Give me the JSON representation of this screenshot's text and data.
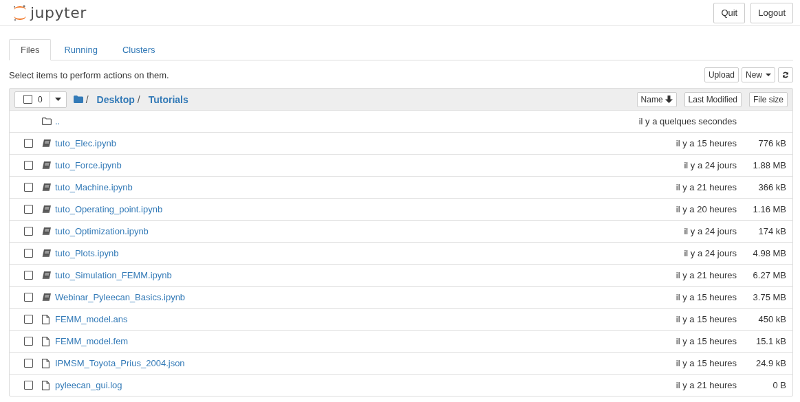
{
  "header": {
    "logo_text": "jupyter",
    "buttons": [
      "Quit",
      "Logout"
    ]
  },
  "tabs": [
    {
      "label": "Files",
      "selected": true
    },
    {
      "label": "Running",
      "selected": false
    },
    {
      "label": "Clusters",
      "selected": false
    }
  ],
  "hint": "Select items to perform actions on them.",
  "actions": {
    "upload": "Upload",
    "new": "New"
  },
  "list_header": {
    "select_all": {
      "checked": false,
      "count": "0"
    },
    "breadcrumb": [
      "Desktop",
      "Tutorials"
    ],
    "separator": "/",
    "sort_buttons": [
      {
        "label": "Name",
        "sorted": true
      },
      {
        "label": "Last Modified",
        "sorted": false
      },
      {
        "label": "File size",
        "sorted": false
      }
    ]
  },
  "items": [
    {
      "kind": "parent",
      "name": "..",
      "modified": "il y a quelques secondes"
    },
    {
      "kind": "notebook",
      "name": "tuto_Elec.ipynb",
      "modified": "il y a 15 heures",
      "size": "776 kB",
      "checked": false
    },
    {
      "kind": "notebook",
      "name": "tuto_Force.ipynb",
      "modified": "il y a 24 jours",
      "size": "1.88 MB",
      "checked": false
    },
    {
      "kind": "notebook",
      "name": "tuto_Machine.ipynb",
      "modified": "il y a 21 heures",
      "size": "366 kB",
      "checked": false
    },
    {
      "kind": "notebook",
      "name": "tuto_Operating_point.ipynb",
      "modified": "il y a 20 heures",
      "size": "1.16 MB",
      "checked": false
    },
    {
      "kind": "notebook",
      "name": "tuto_Optimization.ipynb",
      "modified": "il y a 24 jours",
      "size": "174 kB",
      "checked": false
    },
    {
      "kind": "notebook",
      "name": "tuto_Plots.ipynb",
      "modified": "il y a 24 jours",
      "size": "4.98 MB",
      "checked": false
    },
    {
      "kind": "notebook",
      "name": "tuto_Simulation_FEMM.ipynb",
      "modified": "il y a 21 heures",
      "size": "6.27 MB",
      "checked": false
    },
    {
      "kind": "notebook",
      "name": "Webinar_Pyleecan_Basics.ipynb",
      "modified": "il y a 15 heures",
      "size": "3.75 MB",
      "checked": false
    },
    {
      "kind": "file",
      "name": "FEMM_model.ans",
      "modified": "il y a 15 heures",
      "size": "450 kB",
      "checked": false
    },
    {
      "kind": "file",
      "name": "FEMM_model.fem",
      "modified": "il y a 15 heures",
      "size": "15.1 kB",
      "checked": false
    },
    {
      "kind": "file",
      "name": "IPMSM_Toyota_Prius_2004.json",
      "modified": "il y a 15 heures",
      "size": "24.9 kB",
      "checked": false
    },
    {
      "kind": "file",
      "name": "pyleecan_gui.log",
      "modified": "il y a 21 heures",
      "size": "0 B",
      "checked": false
    }
  ]
}
